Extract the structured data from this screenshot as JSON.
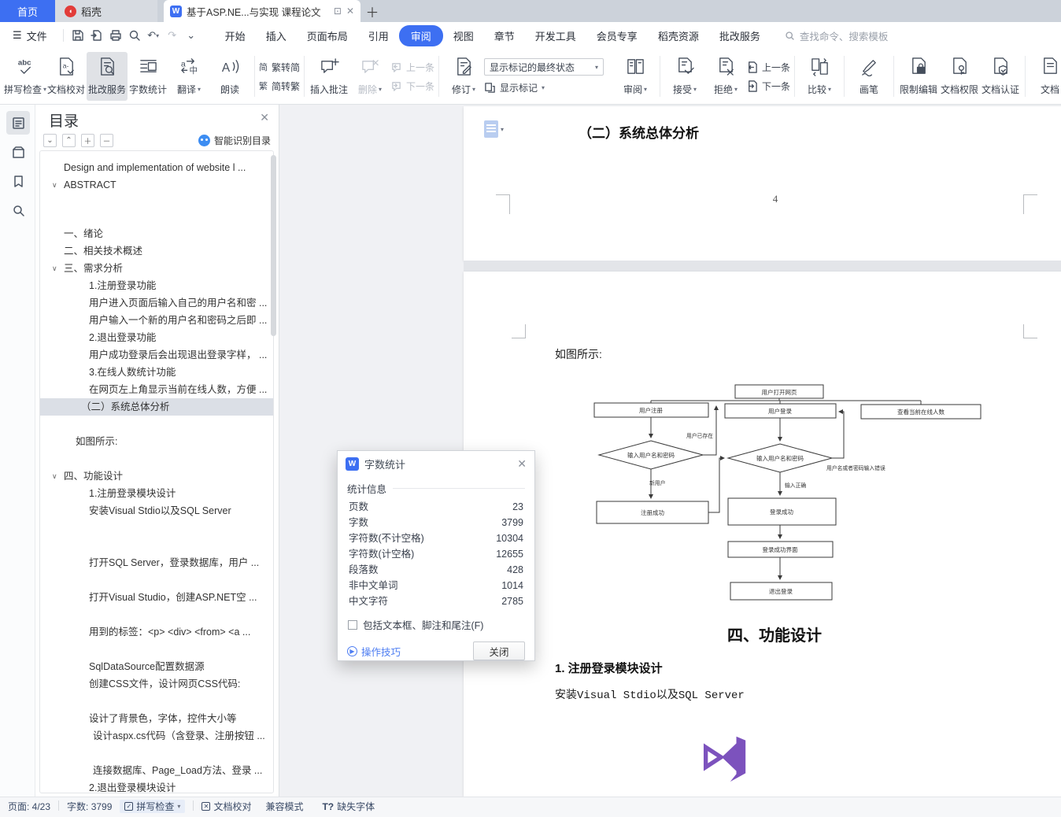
{
  "tab_bar": {
    "home": "首页",
    "docer": "稻壳",
    "document_title": "基于ASP.NE...与实现 课程论文"
  },
  "menu_bar": {
    "file": "文件",
    "items": [
      {
        "label": "开始"
      },
      {
        "label": "插入"
      },
      {
        "label": "页面布局"
      },
      {
        "label": "引用"
      },
      {
        "label": "审阅",
        "active": true
      },
      {
        "label": "视图"
      },
      {
        "label": "章节"
      },
      {
        "label": "开发工具"
      },
      {
        "label": "会员专享"
      },
      {
        "label": "稻壳资源"
      },
      {
        "label": "批改服务"
      }
    ],
    "search_placeholder": "查找命令、搜索模板"
  },
  "ribbon": {
    "spell_check": "拼写检查",
    "proofread": "文档校对",
    "correction_service": "批改服务",
    "word_count": "字数统计",
    "translate": "翻译",
    "read_aloud": "朗读",
    "trad_to_simp": "繁转简",
    "simp_to_trad": "简转繁",
    "insert_comment": "插入批注",
    "delete": "删除",
    "comment_prev": "上一条",
    "comment_next": "下一条",
    "track_changes": "修订",
    "markup_state_value": "显示标记的最终状态",
    "show_markup": "显示标记",
    "review": "审阅",
    "accept": "接受",
    "reject": "拒绝",
    "change_prev": "上一条",
    "change_next": "下一条",
    "compare": "比较",
    "pen": "画笔",
    "restrict_editing": "限制编辑",
    "doc_permission": "文档权限",
    "doc_certification": "文档认证",
    "doc_partial": "文档"
  },
  "toc_panel": {
    "title": "目录",
    "smart_recognition": "智能识别目录",
    "items": [
      {
        "label": "Design and implementation of website l ..."
      },
      {
        "label": "ABSTRACT",
        "chevron": true
      },
      {
        "label": "一、绪论"
      },
      {
        "label": "二、相关技术概述"
      },
      {
        "label": "三、需求分析",
        "chevron": true
      },
      {
        "label": "1.注册登录功能"
      },
      {
        "label": "用户进入页面后输入自己的用户名和密 ..."
      },
      {
        "label": "用户输入一个新的用户名和密码之后即 ..."
      },
      {
        "label": "2.退出登录功能"
      },
      {
        "label": "用户成功登录后会出现退出登录字样， ..."
      },
      {
        "label": "3.在线人数统计功能"
      },
      {
        "label": "在网页左上角显示当前在线人数，方便 ..."
      },
      {
        "label": "（二）系统总体分析",
        "selected": true
      },
      {
        "label": "如图所示:"
      },
      {
        "label": "四、功能设计",
        "chevron": true
      },
      {
        "label": "1.注册登录模块设计"
      },
      {
        "label": "安装Visual Stdio以及SQL Server"
      },
      {
        "label": "打开SQL Server，登录数据库，用户 ..."
      },
      {
        "label": "打开Visual Studio，创建ASP.NET空 ..."
      },
      {
        "label": "用到的标签：<p> <div> <from> <a ..."
      },
      {
        "label": "SqlDataSource配置数据源"
      },
      {
        "label": "创建CSS文件，设计网页CSS代码:"
      },
      {
        "label": "设计了背景色，字体，控件大小等"
      },
      {
        "label": "设计aspx.cs代码（含登录、注册按钮 ..."
      },
      {
        "label": "连接数据库、Page_Load方法、登录 ..."
      },
      {
        "label": "2.退出登录模块设计"
      }
    ]
  },
  "word_count_dialog": {
    "title": "字数统计",
    "section": "统计信息",
    "rows": [
      {
        "label": "页数",
        "value": "23"
      },
      {
        "label": "字数",
        "value": "3799"
      },
      {
        "label": "字符数(不计空格)",
        "value": "10304"
      },
      {
        "label": "字符数(计空格)",
        "value": "12655"
      },
      {
        "label": "段落数",
        "value": "428"
      },
      {
        "label": "非中文单词",
        "value": "1014"
      },
      {
        "label": "中文字符",
        "value": "2785"
      }
    ],
    "checkbox_label": "包括文本框、脚注和尾注(F)",
    "tips_link": "操作技巧",
    "close_button": "关闭"
  },
  "document": {
    "page1": {
      "heading": "（二）系统总体分析",
      "page_number": "4"
    },
    "page2": {
      "intro": "如图所示:",
      "heading": "四、功能设计",
      "sub_heading": "1. 注册登录模块设计",
      "body_line": "安装Visual Stdio以及SQL Server"
    }
  },
  "flowchart": {
    "nodes": {
      "open": "用户打开网页",
      "register": "用户注册",
      "login": "用户登录",
      "online": "查看当前在线人数",
      "input_reg": "输入用户名和密码",
      "input_login": "输入用户名和密码",
      "reg_ok": "注册成功",
      "login_ok": "登录成功",
      "login_ui": "登录成功界面",
      "logout": "退出登录"
    },
    "edge_labels": {
      "user_exists": "用户已存在",
      "new_user": "新用户",
      "input_correct": "输入正确",
      "wrong_input": "用户名或者密码输入错误"
    }
  },
  "status_bar": {
    "page_indicator": "页面: 4/23",
    "word_count": "字数: 3799",
    "spell_check": "拼写检查",
    "proofread": "文档校对",
    "compat_mode": "兼容模式",
    "missing_font": "缺失字体"
  },
  "colors": {
    "accent": "#3D6FF2",
    "vs_logo_purple": "#7C52BD"
  }
}
